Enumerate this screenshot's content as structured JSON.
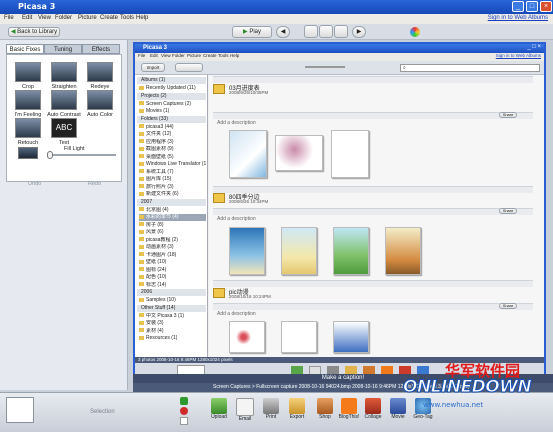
{
  "app": {
    "title": "Picasa 3",
    "inner_title": "Picasa 3",
    "signin": "Sign in to Web Albums"
  },
  "menu": [
    "File",
    "Edit",
    "View",
    "Folder",
    "Picture",
    "Create",
    "Tools",
    "Help"
  ],
  "toolbar": {
    "back": "Back to Library",
    "play": "Play"
  },
  "tabs": [
    "Basic Fixes",
    "Tuning",
    "Effects"
  ],
  "tools": [
    "Crop",
    "Straighten",
    "Redeye",
    "I'm Feeling Lucky",
    "Auto Contrast",
    "Auto Color",
    "Retouch",
    "Text"
  ],
  "fill_light": {
    "label": "Fill Light",
    "level": 0.0
  },
  "left_bottom": [
    "Undo",
    "Redo"
  ],
  "inner": {
    "import": "Import",
    "search_placeholder": "Search"
  },
  "library": [
    {
      "kind": "hdr",
      "text": "Albums (1)"
    },
    {
      "kind": "item",
      "text": "Recently Updated (11)"
    },
    {
      "kind": "hdr",
      "text": "Projects (2)"
    },
    {
      "kind": "item",
      "text": "Screen Captures (2)"
    },
    {
      "kind": "item",
      "text": "Movies (1)"
    },
    {
      "kind": "hdr",
      "text": "Folders (33)"
    },
    {
      "kind": "item",
      "text": "picasa3 (44)"
    },
    {
      "kind": "item",
      "text": "文件夹 (12)"
    },
    {
      "kind": "item",
      "text": "应用程序 (3)"
    },
    {
      "kind": "item",
      "text": "截图素材 (9)"
    },
    {
      "kind": "item",
      "text": "桌面壁纸 (5)"
    },
    {
      "kind": "item",
      "text": "Windows Live Translator (1)"
    },
    {
      "kind": "item",
      "text": "系统工具 (7)"
    },
    {
      "kind": "item",
      "text": "图片库 (15)"
    },
    {
      "kind": "item",
      "text": "旅行照片 (3)"
    },
    {
      "kind": "item",
      "text": "新建文件夹 (6)"
    },
    {
      "kind": "hdr",
      "text": "2007"
    },
    {
      "kind": "item",
      "text": "北京图 (4)"
    },
    {
      "kind": "item",
      "text": "水彩的季节 (4)",
      "sel": true
    },
    {
      "kind": "item",
      "text": "房子 (8)"
    },
    {
      "kind": "item",
      "text": "风景 (6)"
    },
    {
      "kind": "item",
      "text": "picasa教程 (2)"
    },
    {
      "kind": "item",
      "text": "动画素材 (3)"
    },
    {
      "kind": "item",
      "text": "卡通图片 (18)"
    },
    {
      "kind": "item",
      "text": "壁纸 (10)"
    },
    {
      "kind": "item",
      "text": "图标 (24)"
    },
    {
      "kind": "item",
      "text": "配色 (10)"
    },
    {
      "kind": "item",
      "text": "标志 (14)"
    },
    {
      "kind": "hdr",
      "text": "2006"
    },
    {
      "kind": "item",
      "text": "Samples (10)"
    },
    {
      "kind": "hdr",
      "text": "Other Stuff (14)"
    },
    {
      "kind": "item",
      "text": "中文 Picasa 3 (1)"
    },
    {
      "kind": "item",
      "text": "安装 (3)"
    },
    {
      "kind": "item",
      "text": "素材 (4)"
    },
    {
      "kind": "item",
      "text": "Resources (1)"
    }
  ],
  "folders": [
    {
      "name": "03月进度表",
      "date": "2008/9/26/10/35PM",
      "desc": "Add a description"
    },
    {
      "name": "80四季分边",
      "date": "2008/9/26 10:34PM",
      "desc": "Add a description"
    },
    {
      "name": "pic动漫",
      "date": "2008/10/16 10:24PM",
      "desc": "Add a description"
    }
  ],
  "share": "Share",
  "inner_status": "3 photos  2008-10-16 9:46PM  1280x1024 pixels",
  "caption": "Make a caption!",
  "outer_status": "Screen Captures > Fullscreen capture 2008-10-16 94024.bmp    2008-10-16 9:46PM    1280x1024 pixels    3.8MB    (3 of 3)",
  "selection": "Selection",
  "actions": [
    "Upload",
    "Email",
    "Print",
    "Export",
    "Shop",
    "BlogThis!",
    "Collage",
    "Movie",
    "Geo-Tag"
  ],
  "watermark": {
    "cn": "华军软件园",
    "en": "ONLINEDOWN",
    "url": "www.newhua.net"
  },
  "colors": {
    "titlebar": "#1d50c2",
    "accent": "#2a5fd3",
    "folder": "#f0c64a"
  }
}
